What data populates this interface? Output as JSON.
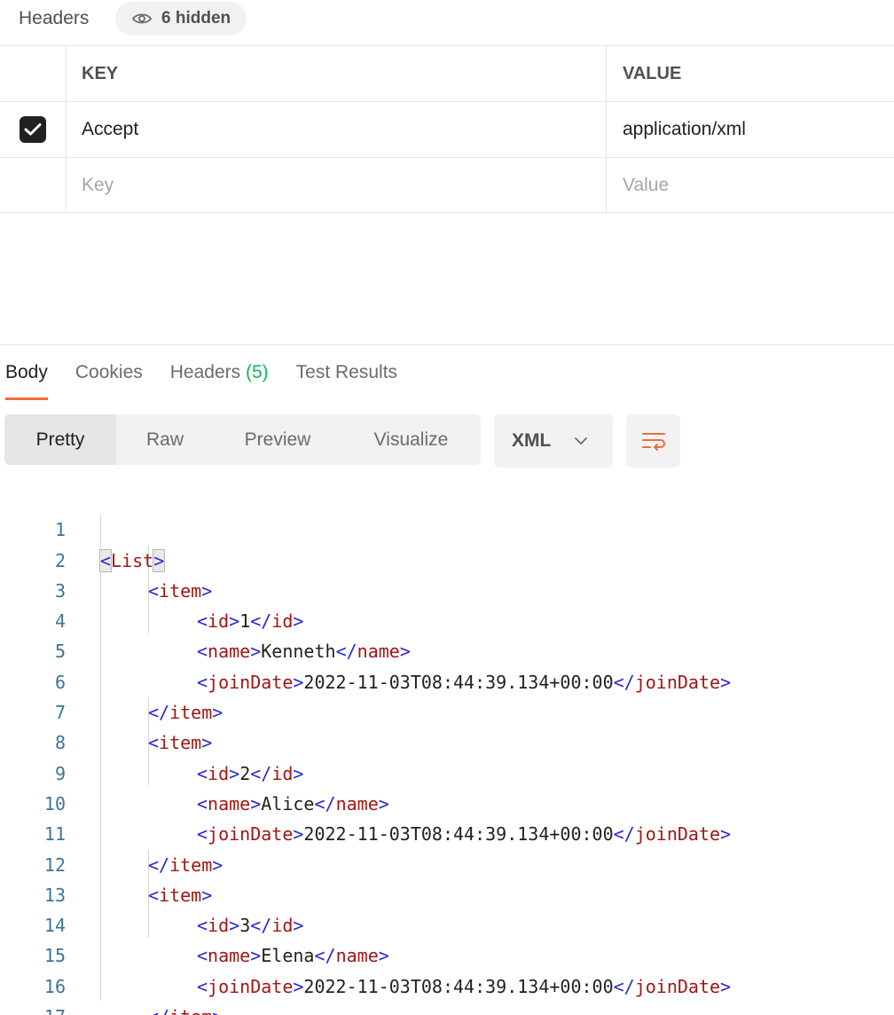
{
  "request_headers": {
    "title": "Headers",
    "hidden_label": "6 hidden",
    "columns": {
      "key": "KEY",
      "value": "VALUE"
    },
    "rows": [
      {
        "enabled": true,
        "key": "Accept",
        "value": "application/xml"
      }
    ],
    "new_row": {
      "key_placeholder": "Key",
      "value_placeholder": "Value"
    }
  },
  "response": {
    "tabs": [
      {
        "label": "Body",
        "active": true
      },
      {
        "label": "Cookies",
        "active": false
      },
      {
        "label": "Headers",
        "count": "(5)",
        "active": false
      },
      {
        "label": "Test Results",
        "active": false
      }
    ],
    "view_modes": [
      "Pretty",
      "Raw",
      "Preview",
      "Visualize"
    ],
    "active_view_mode": "Pretty",
    "format": "XML",
    "accent_color": "#f26b3a",
    "count_color": "#0cbb52"
  },
  "code": {
    "line_numbers": [
      "1",
      "2",
      "3",
      "4",
      "5",
      "6",
      "7",
      "8",
      "9",
      "10",
      "11",
      "12",
      "13",
      "14",
      "15",
      "16",
      "17"
    ],
    "items": [
      {
        "id": "1",
        "name": "Kenneth",
        "joinDate": "2022-11-03T08:44:39.134+00:00"
      },
      {
        "id": "2",
        "name": "Alice",
        "joinDate": "2022-11-03T08:44:39.134+00:00"
      },
      {
        "id": "3",
        "name": "Elena",
        "joinDate": "2022-11-03T08:44:39.134+00:00"
      }
    ],
    "tags": {
      "root": "List",
      "item": "item",
      "id": "id",
      "name": "name",
      "joinDate": "joinDate"
    }
  }
}
